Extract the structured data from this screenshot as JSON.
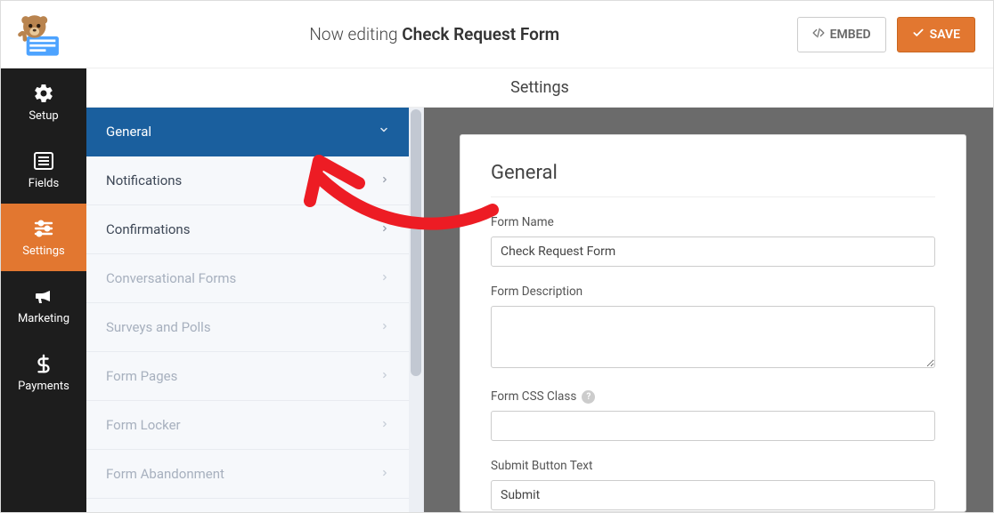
{
  "header": {
    "now_editing": "Now editing",
    "form_name": "Check Request Form",
    "embed": "EMBED",
    "save": "SAVE"
  },
  "nav": {
    "items": [
      {
        "id": "setup",
        "label": "Setup",
        "icon": "gear"
      },
      {
        "id": "fields",
        "label": "Fields",
        "icon": "list"
      },
      {
        "id": "settings",
        "label": "Settings",
        "icon": "sliders",
        "active": true
      },
      {
        "id": "marketing",
        "label": "Marketing",
        "icon": "bullhorn"
      },
      {
        "id": "payments",
        "label": "Payments",
        "icon": "dollar"
      }
    ]
  },
  "titlebar": "Settings",
  "settings_list": [
    {
      "id": "general",
      "label": "General",
      "active": true
    },
    {
      "id": "notifications",
      "label": "Notifications"
    },
    {
      "id": "confirmations",
      "label": "Confirmations"
    },
    {
      "id": "conv-forms",
      "label": "Conversational Forms",
      "disabled": true
    },
    {
      "id": "surveys",
      "label": "Surveys and Polls",
      "disabled": true
    },
    {
      "id": "form-pages",
      "label": "Form Pages",
      "disabled": true
    },
    {
      "id": "form-locker",
      "label": "Form Locker",
      "disabled": true
    },
    {
      "id": "abandonment",
      "label": "Form Abandonment",
      "disabled": true
    }
  ],
  "panel": {
    "heading": "General",
    "fields": {
      "form_name": {
        "label": "Form Name",
        "value": "Check Request Form"
      },
      "form_desc": {
        "label": "Form Description",
        "value": ""
      },
      "css_class": {
        "label": "Form CSS Class",
        "value": ""
      },
      "submit_text": {
        "label": "Submit Button Text",
        "value": "Submit"
      }
    }
  }
}
